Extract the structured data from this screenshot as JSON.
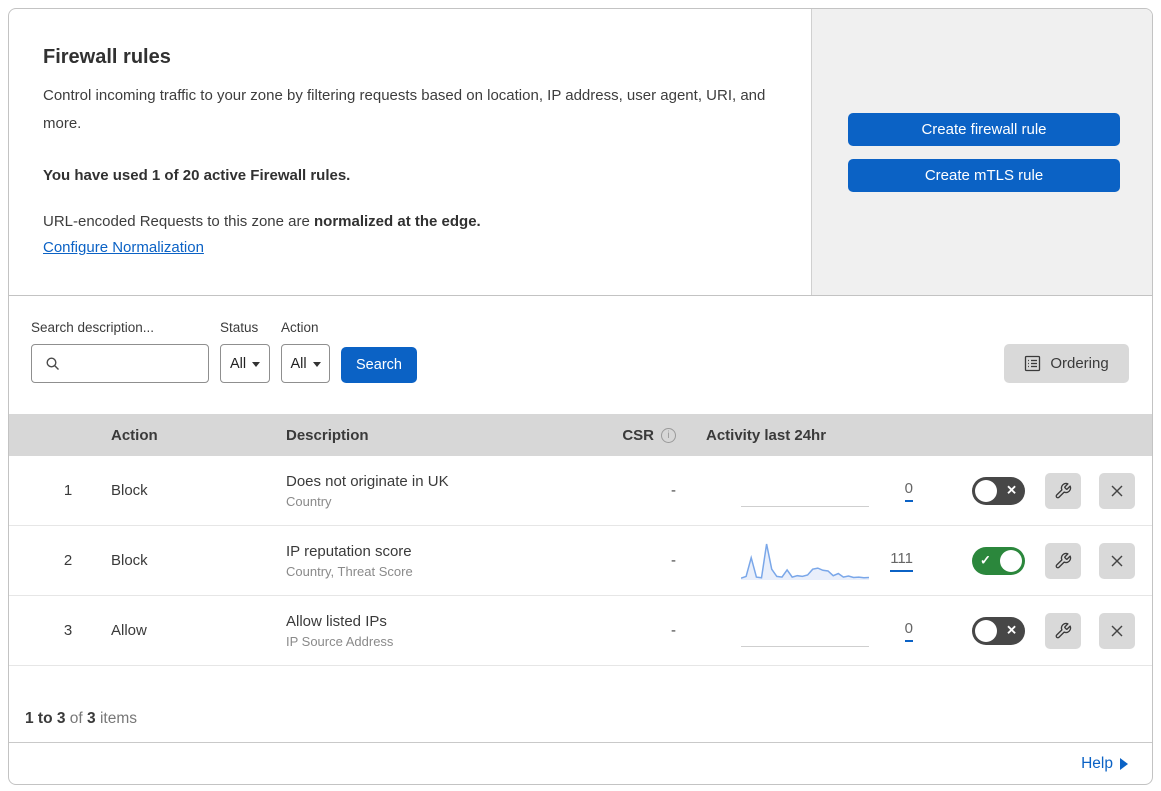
{
  "header": {
    "title": "Firewall rules",
    "description": "Control incoming traffic to your zone by filtering requests based on location, IP address, user agent, URI, and more.",
    "usage_text": "You have used 1 of 20 active Firewall rules.",
    "normalization_prefix": "URL-encoded Requests to this zone are",
    "normalization_bold": "normalized at the edge.",
    "normalization_link": "Configure Normalization",
    "create_firewall_label": "Create firewall rule",
    "create_mtls_label": "Create mTLS rule"
  },
  "filters": {
    "search_label": "Search description...",
    "search_value": "",
    "status_label": "Status",
    "status_value": "All",
    "action_label": "Action",
    "action_value": "All",
    "search_button_label": "Search",
    "ordering_button_label": "Ordering"
  },
  "table": {
    "columns": {
      "action": "Action",
      "description": "Description",
      "csr": "CSR",
      "activity": "Activity last 24hr"
    },
    "rows": [
      {
        "index": "1",
        "action": "Block",
        "description": "Does not originate in UK",
        "match_fields": "Country",
        "csr": "-",
        "activity_count": "0",
        "enabled": false
      },
      {
        "index": "2",
        "action": "Block",
        "description": "IP reputation score",
        "match_fields": "Country, Threat Score",
        "csr": "-",
        "activity_count": "111",
        "enabled": true,
        "sparkline": [
          5,
          10,
          62,
          8,
          6,
          100,
          30,
          10,
          8,
          28,
          8,
          12,
          10,
          14,
          30,
          33,
          27,
          25,
          12,
          18,
          8,
          11,
          7,
          8,
          6,
          7
        ]
      },
      {
        "index": "3",
        "action": "Allow",
        "description": "Allow listed IPs",
        "match_fields": "IP Source Address",
        "csr": "-",
        "activity_count": "0",
        "enabled": false
      }
    ]
  },
  "footer": {
    "range": "1 to 3",
    "of_label": "of",
    "total": "3",
    "items_label": "items",
    "help_label": "Help"
  },
  "icons": {
    "check": "✓",
    "cross": "✕",
    "info": "i"
  },
  "colors": {
    "accent_blue": "#0b62c5",
    "toggle_on_green": "#2b873c",
    "toggle_off_gray": "#474747",
    "sparkline_blue": "#7aa7e9",
    "sparkline_fill": "#e9effb",
    "panel_gray": "#f0f0f0",
    "table_header_gray": "#d7d7d7",
    "control_gray": "#d9d9d9"
  }
}
